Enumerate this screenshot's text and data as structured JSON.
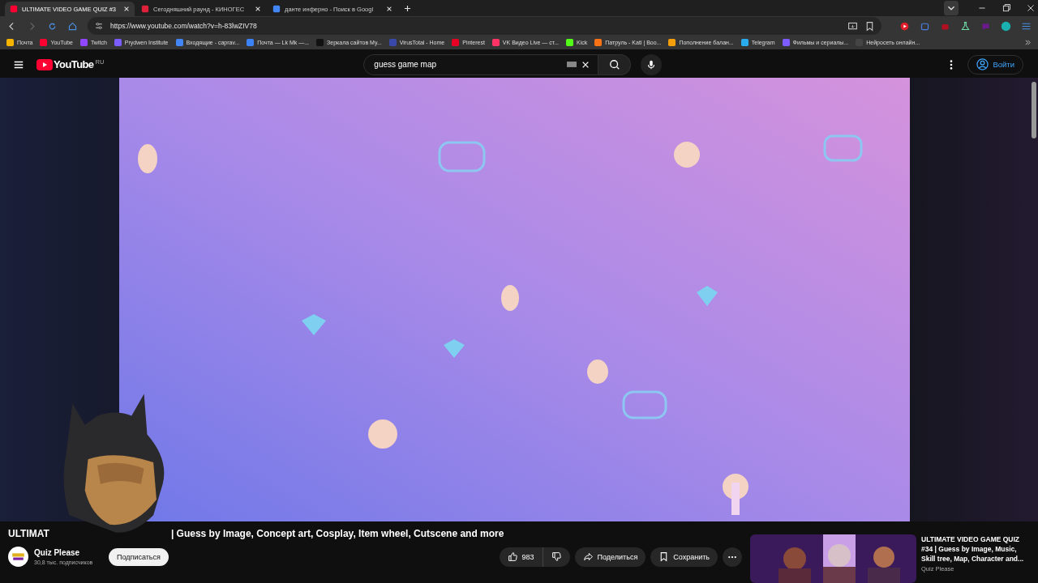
{
  "tabs": [
    {
      "title": "ULTIMATE VIDEO GAME QUIZ #3",
      "color": "#ff0033",
      "selected": true
    },
    {
      "title": "Сегодняшний раунд - КИНОГЕС",
      "color": "#e0213a",
      "selected": false
    },
    {
      "title": "данте инферно - Поиск в Googl",
      "color": "#4285f4",
      "selected": false
    }
  ],
  "address_bar": {
    "url": "https://www.youtube.com/watch?v=h-83lwZIV78"
  },
  "bookmarks": [
    {
      "label": "Почта",
      "color": "#f5b400"
    },
    {
      "label": "YouTube",
      "color": "#ff0033"
    },
    {
      "label": "Twitch",
      "color": "#9146ff"
    },
    {
      "label": "Prydwen Institute",
      "color": "#7a5cff"
    },
    {
      "label": "Входящие - caprav...",
      "color": "#4285f4"
    },
    {
      "label": "Почта — Lk Mk —...",
      "color": "#3b82f6"
    },
    {
      "label": "Зеркала сайтов My...",
      "color": "#111111"
    },
    {
      "label": "VirusTotal - Home",
      "color": "#3949ab"
    },
    {
      "label": "Pinterest",
      "color": "#e60023"
    },
    {
      "label": "VK Видео Live — ст...",
      "color": "#ff3366"
    },
    {
      "label": "Kick",
      "color": "#53fc18"
    },
    {
      "label": "Патруль - Kati | Boo...",
      "color": "#f97316"
    },
    {
      "label": "Пополнение балан...",
      "color": "#f59e0b"
    },
    {
      "label": "Telegram",
      "color": "#2aabee"
    },
    {
      "label": "Фильмы и сериалы...",
      "color": "#7c5cff"
    },
    {
      "label": "Нейросеть онлайн...",
      "color": "#444444"
    }
  ],
  "youtube_header": {
    "logo_text": "YouTube",
    "region": "RU",
    "search_value": "guess game map",
    "sign_in": "Войти"
  },
  "video_title": {
    "visible_start": "ULTIMAT",
    "visible_end": "| Guess by Image, Concept art, Cosplay, Item wheel, Cutscene and more"
  },
  "channel": {
    "name": "Quiz Please",
    "subscribers": "30,8 тыс. подписчиков",
    "subscribe": "Подписаться"
  },
  "actions": {
    "likes": "983",
    "share": "Поделиться",
    "save": "Сохранить"
  },
  "recommended": {
    "title": "ULTIMATE VIDEO GAME QUIZ #34 | Guess by Image, Music, Skill tree, Map, Character and...",
    "channel": "Quiz Please"
  }
}
